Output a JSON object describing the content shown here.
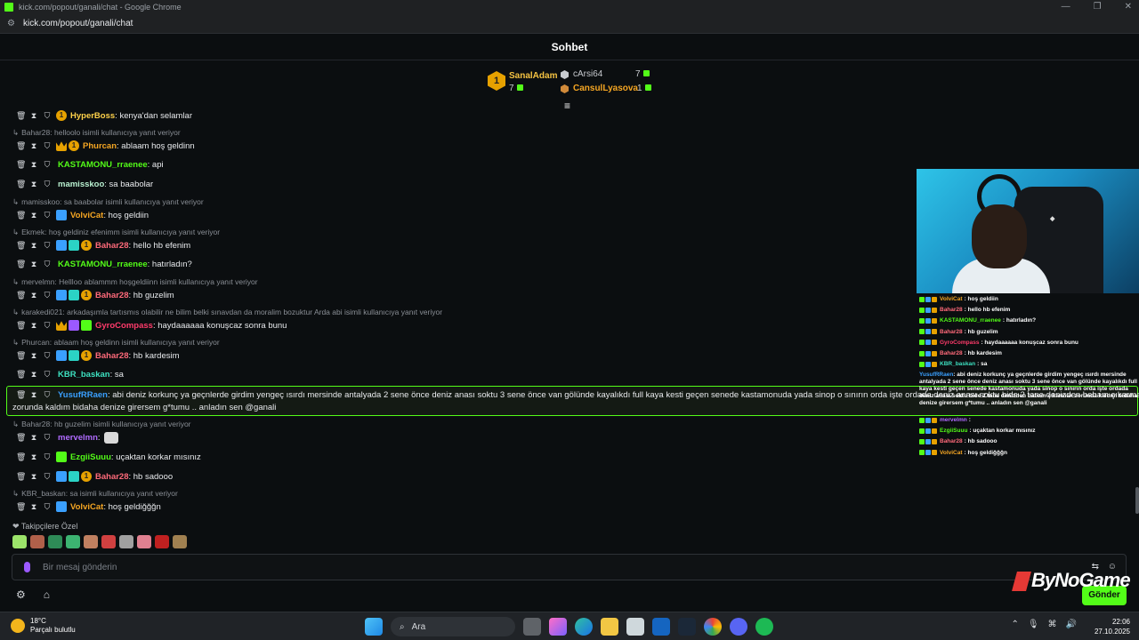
{
  "window": {
    "title": "kick.com/popout/ganali/chat - Google Chrome",
    "url": "kick.com/popout/ganali/chat"
  },
  "header": {
    "title": "Sohbet"
  },
  "leaderboard": {
    "first": {
      "rank": "1",
      "name": "SanalAdam",
      "count": "7"
    },
    "second": {
      "name": "cArsi64",
      "count": "7"
    },
    "third": {
      "name": "CansulLyasova",
      "count": "1"
    }
  },
  "chat": [
    {
      "type": "msg",
      "user": "HyperBoss",
      "text": ": kenya'dan selamlar",
      "color": "#ffd24a",
      "badges": [
        "gold"
      ]
    },
    {
      "type": "reply",
      "text": "Bahar28:        helloolo isimli kullanıcıya yanıt veriyor"
    },
    {
      "type": "msg",
      "user": "Phurcan",
      "text": ": ablaam hoş geldinn",
      "color": "#f5a623",
      "badges": [
        "crown",
        "gold"
      ]
    },
    {
      "type": "msg",
      "user": "KASTAMONU_rraenee",
      "text": ": api",
      "color": "#53fc18",
      "badges": []
    },
    {
      "type": "msg",
      "user": "mamisskoo",
      "text": ": sa baabolar",
      "color": "#b8f0d0",
      "badges": []
    },
    {
      "type": "reply",
      "text": "mamisskoo: sa baabolar isimli kullanıcıya yanıt veriyor"
    },
    {
      "type": "msg",
      "user": "VolviCat",
      "text": ": hoş geldiin",
      "color": "#f5a623",
      "badges": [
        "blue"
      ]
    },
    {
      "type": "reply",
      "text": "Ekmek: hoş geldiniz efenimm isimli kullanıcıya yanıt veriyor"
    },
    {
      "type": "msg",
      "user": "Bahar28",
      "text": ": hello hb efenim",
      "color": "#ff6a7a",
      "badges": [
        "blue",
        "teal",
        "gold"
      ]
    },
    {
      "type": "msg",
      "user": "KASTAMONU_rraenee",
      "text": ": hatırladın?",
      "color": "#53fc18",
      "badges": []
    },
    {
      "type": "reply",
      "text": "mervelmn: Hellloo ablammm hoşgeldiinn isimli kullanıcıya yanıt veriyor"
    },
    {
      "type": "msg",
      "user": "Bahar28",
      "text": ": hb guzelim",
      "color": "#ff6a7a",
      "badges": [
        "blue",
        "teal",
        "gold"
      ]
    },
    {
      "type": "reply",
      "text": "karakedi021: arkadaşımla tartısmıs olabilir ne bilim belki sınavdan da moralim bozuktur Arda abi isimli kullanıcıya yanıt veriyor"
    },
    {
      "type": "msg",
      "user": "GyroCompass",
      "text": ": haydaaaaaa konuşcaz sonra bunu",
      "color": "#ff3b6b",
      "badges": [
        "crown",
        "purple",
        "green"
      ]
    },
    {
      "type": "reply",
      "text": "Phurcan: ablaam hoş geldinn isimli kullanıcıya yanıt veriyor"
    },
    {
      "type": "msg",
      "user": "Bahar28",
      "text": ": hb kardesim",
      "color": "#ff6a7a",
      "badges": [
        "blue",
        "teal",
        "gold"
      ]
    },
    {
      "type": "msg",
      "user": "KBR_baskan",
      "text": ": sa",
      "color": "#3de0c0",
      "badges": []
    }
  ],
  "highlight": {
    "user": "YusufRRaen",
    "line1": ": abi deniz korkunç ya geçnlerde girdim yengeç ısırdı mersinde antalyada 2 sene önce deniz anası soktu 3 sene önce van gölünde kayalıkdı full kaya kesti geçen senede kastamonuda yada sinop o sınırın orda işte ordada deniz anası soktu bide 2 tane denizden babam çıkarmak",
    "line2": "zorunda kaldım bidaha denize girersem g*tumu .. anladın sen @ganali"
  },
  "chat2": [
    {
      "type": "reply",
      "text": "Bahar28: hb guzelim isimli kullanıcıya yanıt veriyor"
    },
    {
      "type": "msg",
      "user": "mervelmn",
      "text": ":",
      "color": "#b06bff",
      "badges": [],
      "emote": true
    },
    {
      "type": "msg",
      "user": "EzgiiSuuu",
      "text": ": uçaktan korkar mısınız",
      "color": "#53fc18",
      "badges": [
        "green"
      ]
    },
    {
      "type": "msg",
      "user": "Bahar28",
      "text": ": hb sadooo",
      "color": "#ff6a7a",
      "badges": [
        "blue",
        "teal",
        "gold"
      ]
    },
    {
      "type": "reply",
      "text": "KBR_baskan: sa isimli kullanıcıya yanıt veriyor"
    },
    {
      "type": "msg",
      "user": "VolviCat",
      "text": ": hoş geldiğğğn",
      "color": "#f5a623",
      "badges": [
        "blue"
      ]
    }
  ],
  "followers_label": "Takipçilere Özel",
  "input": {
    "placeholder": "Bir mesaj gönderin",
    "send": "Gönder"
  },
  "overlay_chat": [
    {
      "user": "VolviCat",
      "text": ": hoş geldiin",
      "color": "#f5a623"
    },
    {
      "user": "Bahar28",
      "text": ": hello hb efenim",
      "color": "#ff6a7a"
    },
    {
      "user": "KASTAMONU_rraenee",
      "text": ": hatırladın?",
      "color": "#53fc18"
    },
    {
      "user": "Bahar28",
      "text": ": hb guzelim",
      "color": "#ff6a7a"
    },
    {
      "user": "GyroCompass",
      "text": ": haydaaaaaa konuşcaz sonra bunu",
      "color": "#ff3b6b"
    },
    {
      "user": "Bahar28",
      "text": ": hb kardesim",
      "color": "#ff6a7a"
    },
    {
      "user": "KBR_baskan",
      "text": ": sa",
      "color": "#3de0c0"
    }
  ],
  "overlay_long": {
    "user": "YusufRRaen",
    "text": ": abi deniz korkunç ya geçnlerde girdim yengeç ısırdı mersinde antalyada 2 sene önce deniz anası soktu 3 sene önce van gölünde kayalıkdı full kaya kesti geçen senede kastamonuda yada sinop o sınırın orda işte ordada deniz anası soktu bide 2 tane denizden babam çıkarmak zorunda kaldım bidaha denize girersem g*tumu .. anladın sen @ganali"
  },
  "overlay_chat2": [
    {
      "user": "mervelmn",
      "text": ":",
      "color": "#b06bff"
    },
    {
      "user": "EzgiiSuuu",
      "text": ": uçaktan korkar mısınız",
      "color": "#53fc18"
    },
    {
      "user": "Bahar28",
      "text": ": hb sadooo",
      "color": "#ff6a7a"
    },
    {
      "user": "VolviCat",
      "text": ": hoş geldiğğğn",
      "color": "#f5a623"
    }
  ],
  "brand": "ByNoGame",
  "taskbar": {
    "temp": "18°C",
    "weather": "Parçalı bulutlu",
    "search": "Ara",
    "time": "22:06",
    "date": "27.10.2025"
  }
}
